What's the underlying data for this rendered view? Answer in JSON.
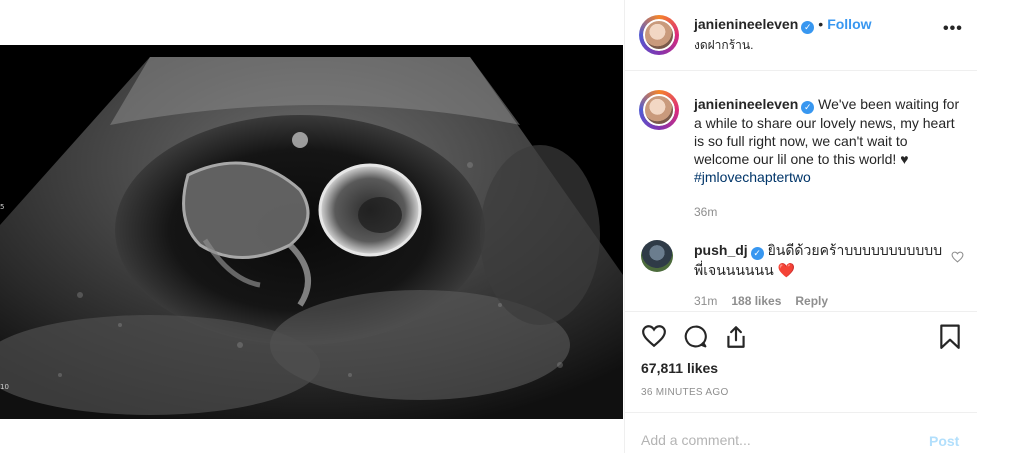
{
  "post": {
    "author": "janienineeleven",
    "follow_label": "Follow",
    "separator": "•",
    "location": "งดฝากร้าน.",
    "more_label": "•••",
    "caption_text": "We've been waiting for a while to share our lovely news, my heart is so full right now, we can't wait to welcome our lil one to this world! ♥",
    "caption_hashtag": "#jmlovechaptertwo",
    "caption_time": "36m"
  },
  "media": {
    "scale_marks": [
      "5",
      "10"
    ]
  },
  "comments": [
    {
      "author": "push_dj",
      "text": "ยินดีด้วยคร้าบบบบบบบบบบบพี่เจนนนนนน ❤️",
      "time": "31m",
      "likes": "188 likes",
      "reply_label": "Reply"
    }
  ],
  "actions": {
    "likes_count": "67,811 likes",
    "posted_ago": "36 MINUTES AGO"
  },
  "comment_box": {
    "placeholder": "Add a comment...",
    "post_label": "Post"
  },
  "colors": {
    "accent": "#3897f0",
    "hashtag": "#003569",
    "muted": "#8e8e8e"
  }
}
